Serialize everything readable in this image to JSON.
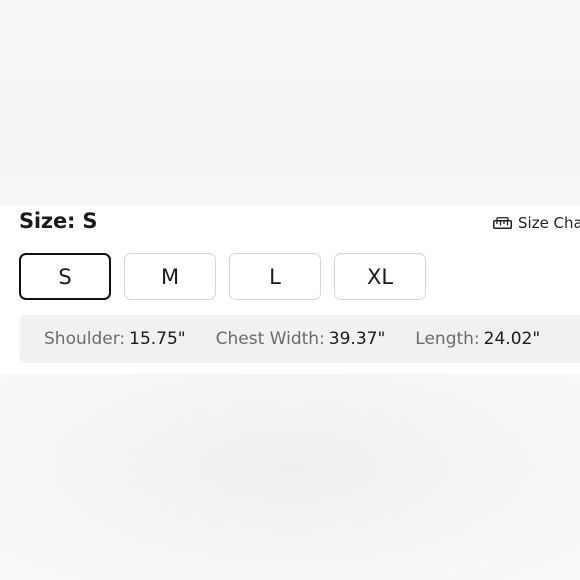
{
  "size_selector": {
    "title_prefix": "Size:",
    "selected_size": "S",
    "size_chart_label": "Size Cha",
    "options": [
      "S",
      "M",
      "L",
      "XL"
    ]
  },
  "measurements": [
    {
      "label": "Shoulder:",
      "value": "15.75\""
    },
    {
      "label": "Chest Width:",
      "value": "39.37\""
    },
    {
      "label": "Length:",
      "value": "24.02\""
    }
  ]
}
